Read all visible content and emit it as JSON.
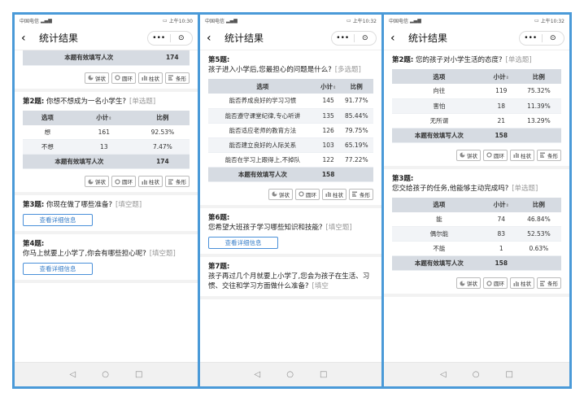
{
  "status": {
    "carrier": "中国电信",
    "time_1": "上午10:30",
    "time_2": "上午10:32",
    "time_3": "上午10:32"
  },
  "nav": {
    "title": "统计结果",
    "back": "‹",
    "more": "•••",
    "target": "⊙"
  },
  "chart_buttons": [
    "饼状",
    "圆环",
    "柱状",
    "条形"
  ],
  "table_headers": {
    "option": "选项",
    "count": "小计",
    "ratio": "比例",
    "total_label": "本题有效填写人次"
  },
  "detail_button": "查看详细信息",
  "nav_keys": {
    "back": "◁",
    "home": "○",
    "recent": "□"
  },
  "phone1": {
    "top_total": "174",
    "q2": {
      "label": "第2题:",
      "text": "你想不想成为一名小学生?",
      "type": "[单选题]",
      "rows": [
        {
          "option": "想",
          "count": "161",
          "ratio": "92.53%"
        },
        {
          "option": "不想",
          "count": "13",
          "ratio": "7.47%"
        }
      ],
      "total": "174"
    },
    "q3": {
      "label": "第3题:",
      "text": "你现在做了哪些准备?",
      "type": "[填空题]"
    },
    "q4": {
      "label": "第4题:",
      "text": "你马上就要上小学了,你会有哪些担心呢?",
      "type": "[填空题]"
    }
  },
  "phone2": {
    "q5": {
      "label": "第5题:",
      "text": "孩子进入小学后,您最担心的问题是什么?",
      "type": "[多选题]",
      "rows": [
        {
          "option": "能否养成良好的学习习惯",
          "count": "145",
          "ratio": "91.77%"
        },
        {
          "option": "能否遵守课堂纪律,专心听讲",
          "count": "135",
          "ratio": "85.44%"
        },
        {
          "option": "能否适应老师的教育方法",
          "count": "126",
          "ratio": "79.75%"
        },
        {
          "option": "能否建立良好的人际关系",
          "count": "103",
          "ratio": "65.19%"
        },
        {
          "option": "能否在学习上跟得上,不掉队",
          "count": "122",
          "ratio": "77.22%"
        }
      ],
      "total": "158"
    },
    "q6": {
      "label": "第6题:",
      "text": "您希望大班孩子学习哪些知识和技能?",
      "type": "[填空题]"
    },
    "q7": {
      "label": "第7题:",
      "text": "孩子再过几个月就要上小学了,您会为孩子在生活、习惯、交往和学习方面做什么准备?",
      "type": "[填空"
    }
  },
  "phone3": {
    "q2": {
      "label": "第2题:",
      "text": "您的孩子对小学生活的态度?",
      "type": "[单选题]",
      "rows": [
        {
          "option": "向往",
          "count": "119",
          "ratio": "75.32%"
        },
        {
          "option": "害怕",
          "count": "18",
          "ratio": "11.39%"
        },
        {
          "option": "无所谓",
          "count": "21",
          "ratio": "13.29%"
        }
      ],
      "total": "158"
    },
    "q3": {
      "label": "第3题:",
      "text": "您交给孩子的任务,他能够主动完成吗?",
      "type": "[单选题]",
      "rows": [
        {
          "option": "能",
          "count": "74",
          "ratio": "46.84%"
        },
        {
          "option": "偶尔能",
          "count": "83",
          "ratio": "52.53%"
        },
        {
          "option": "不能",
          "count": "1",
          "ratio": "0.63%"
        }
      ],
      "total": "158"
    }
  }
}
